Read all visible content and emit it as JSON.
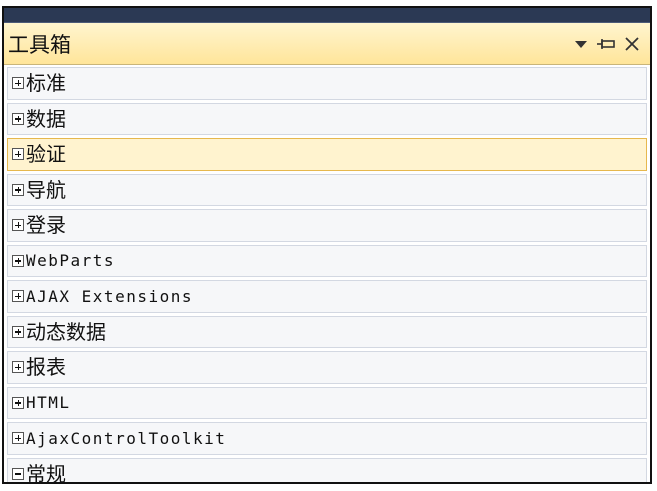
{
  "panel": {
    "title": "工具箱",
    "controls": [
      {
        "icon": "dropdown-arrow-icon"
      },
      {
        "icon": "pin-icon"
      },
      {
        "icon": "close-icon"
      }
    ]
  },
  "colors": {
    "title_bar": "#ffe59a",
    "selected_bg": "#fff3cf",
    "selected_border": "#e6b84e",
    "item_bg": "#f6f7f9"
  },
  "categories": [
    {
      "label": "标准",
      "expanded": false,
      "selected": false
    },
    {
      "label": "数据",
      "expanded": false,
      "selected": false
    },
    {
      "label": "验证",
      "expanded": false,
      "selected": true
    },
    {
      "label": "导航",
      "expanded": false,
      "selected": false
    },
    {
      "label": "登录",
      "expanded": false,
      "selected": false
    },
    {
      "label": "WebParts",
      "expanded": false,
      "selected": false
    },
    {
      "label": "AJAX Extensions",
      "expanded": false,
      "selected": false
    },
    {
      "label": "动态数据",
      "expanded": false,
      "selected": false
    },
    {
      "label": "报表",
      "expanded": false,
      "selected": false
    },
    {
      "label": "HTML",
      "expanded": false,
      "selected": false
    },
    {
      "label": "AjaxControlToolkit",
      "expanded": false,
      "selected": false
    },
    {
      "label": "常规",
      "expanded": true,
      "selected": false
    }
  ]
}
